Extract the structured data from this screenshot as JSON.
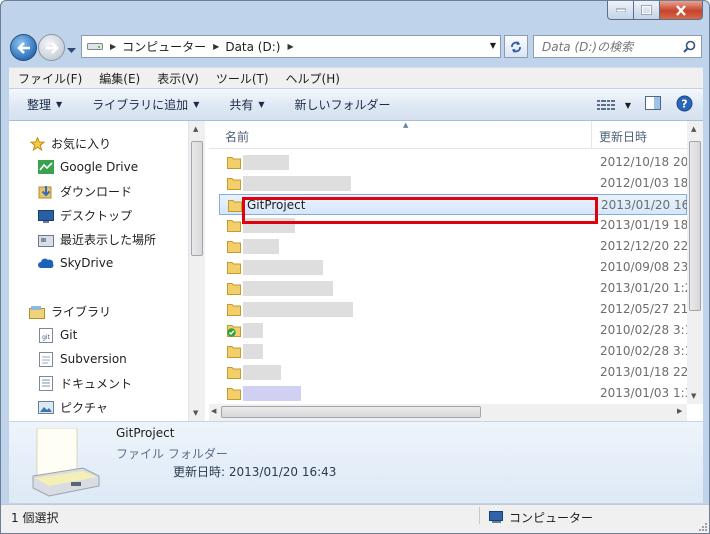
{
  "address": {
    "segments": [
      "コンピューター",
      "Data (D:)"
    ]
  },
  "search": {
    "placeholder": "Data (D:)の検索"
  },
  "menu": [
    "ファイル(F)",
    "編集(E)",
    "表示(V)",
    "ツール(T)",
    "ヘルプ(H)"
  ],
  "toolbar": {
    "organize": "整理",
    "library": "ライブラリに追加",
    "share": "共有",
    "new_folder": "新しいフォルダー"
  },
  "nav": {
    "favorites": "お気に入り",
    "google_drive": "Google Drive",
    "downloads": "ダウンロード",
    "desktop": "デスクトップ",
    "recent": "最近表示した場所",
    "skydrive": "SkyDrive",
    "libraries": "ライブラリ",
    "git": "Git",
    "subversion": "Subversion",
    "documents": "ドキュメント",
    "pictures": "ピクチャ"
  },
  "columns": {
    "name": "名前",
    "date": "更新日時"
  },
  "files": [
    {
      "name": "",
      "date": "2012/10/18 20",
      "blur": 46
    },
    {
      "name": "",
      "date": "2012/01/03 18",
      "blur": 108
    },
    {
      "name": "GitProject",
      "date": "2013/01/20 16",
      "blur": 0
    },
    {
      "name": "",
      "date": "2013/01/19 18",
      "blur": 52
    },
    {
      "name": "",
      "date": "2012/12/20 22",
      "blur": 36
    },
    {
      "name": "",
      "date": "2010/09/08 23",
      "blur": 80
    },
    {
      "name": "",
      "date": "2013/01/20 1:2",
      "blur": 90
    },
    {
      "name": "",
      "date": "2012/05/27 21",
      "blur": 110
    },
    {
      "name": "",
      "date": "2010/02/28 3:1",
      "blur": 20
    },
    {
      "name": "",
      "date": "2010/02/28 3:1",
      "blur": 20
    },
    {
      "name": "",
      "date": "2013/01/18 22",
      "blur": 38
    },
    {
      "name": "",
      "date": "2013/01/03 1:3",
      "blur": 58
    }
  ],
  "details": {
    "name": "GitProject",
    "type": "ファイル フォルダー",
    "modified": "更新日時: 2013/01/20 16:43"
  },
  "status": {
    "selection": "1 個選択",
    "location": "コンピューター"
  }
}
